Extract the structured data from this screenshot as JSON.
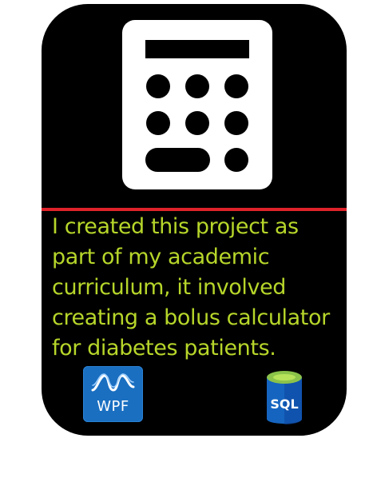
{
  "card": {
    "description": "I created this project as part of my academic curriculum, it involved creating a bolus calculator for diabetes patients."
  },
  "logos": {
    "wpf_label": "WPF",
    "sql_label": "SQL"
  },
  "icons": {
    "main": "calculator-icon",
    "left_logo": "wpf-logo-icon",
    "right_logo": "sql-database-icon"
  },
  "colors": {
    "card_background": "#000000",
    "divider": "#e0222b",
    "text": "#b6d62a",
    "wpf_blue": "#1a6fc1",
    "sql_blue": "#1565c0",
    "sql_green": "#8bc34a"
  }
}
